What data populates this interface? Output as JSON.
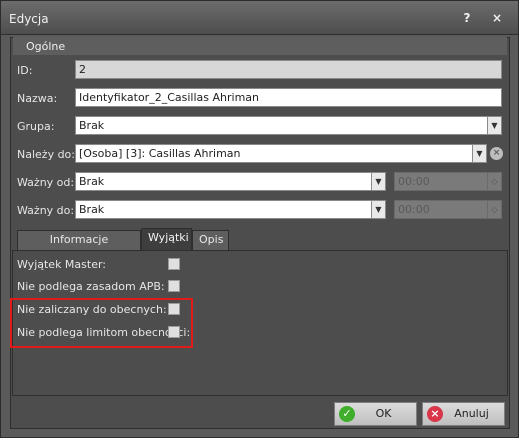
{
  "window": {
    "title": "Edycja",
    "help_icon": "?",
    "close_icon": "×"
  },
  "group": {
    "title": "Ogólne"
  },
  "fields": {
    "id": {
      "label": "ID:",
      "value": "2"
    },
    "name": {
      "label": "Nazwa:",
      "value": "Identyfikator_2_Casillas Ahriman"
    },
    "group": {
      "label": "Grupa:",
      "value": "Brak"
    },
    "belongs": {
      "label": "Należy do:",
      "value": "[Osoba] [3]: Casillas Ahriman"
    },
    "valid_from": {
      "label": "Ważny od:",
      "value": "Brak",
      "time": "00:00"
    },
    "valid_to": {
      "label": "Ważny do:",
      "value": "Brak",
      "time": "00:00"
    }
  },
  "tabs": [
    {
      "label": "Informacje dodatkowe",
      "active": false
    },
    {
      "label": "Wyjątki",
      "active": true
    },
    {
      "label": "Opis",
      "active": false
    }
  ],
  "exceptions": [
    {
      "label": "Wyjątek Master:",
      "checked": false
    },
    {
      "label": "Nie podlega zasadom APB:",
      "checked": false
    },
    {
      "label": "Nie zaliczany do obecnych:",
      "checked": false
    },
    {
      "label": "Nie podlega limitom obecności:",
      "checked": false
    }
  ],
  "footer": {
    "ok_label": "OK",
    "cancel_label": "Anuluj"
  },
  "colors": {
    "highlight": "#e21a1a",
    "ok_icon": "#3fae2a",
    "cancel_icon": "#d9364a"
  }
}
